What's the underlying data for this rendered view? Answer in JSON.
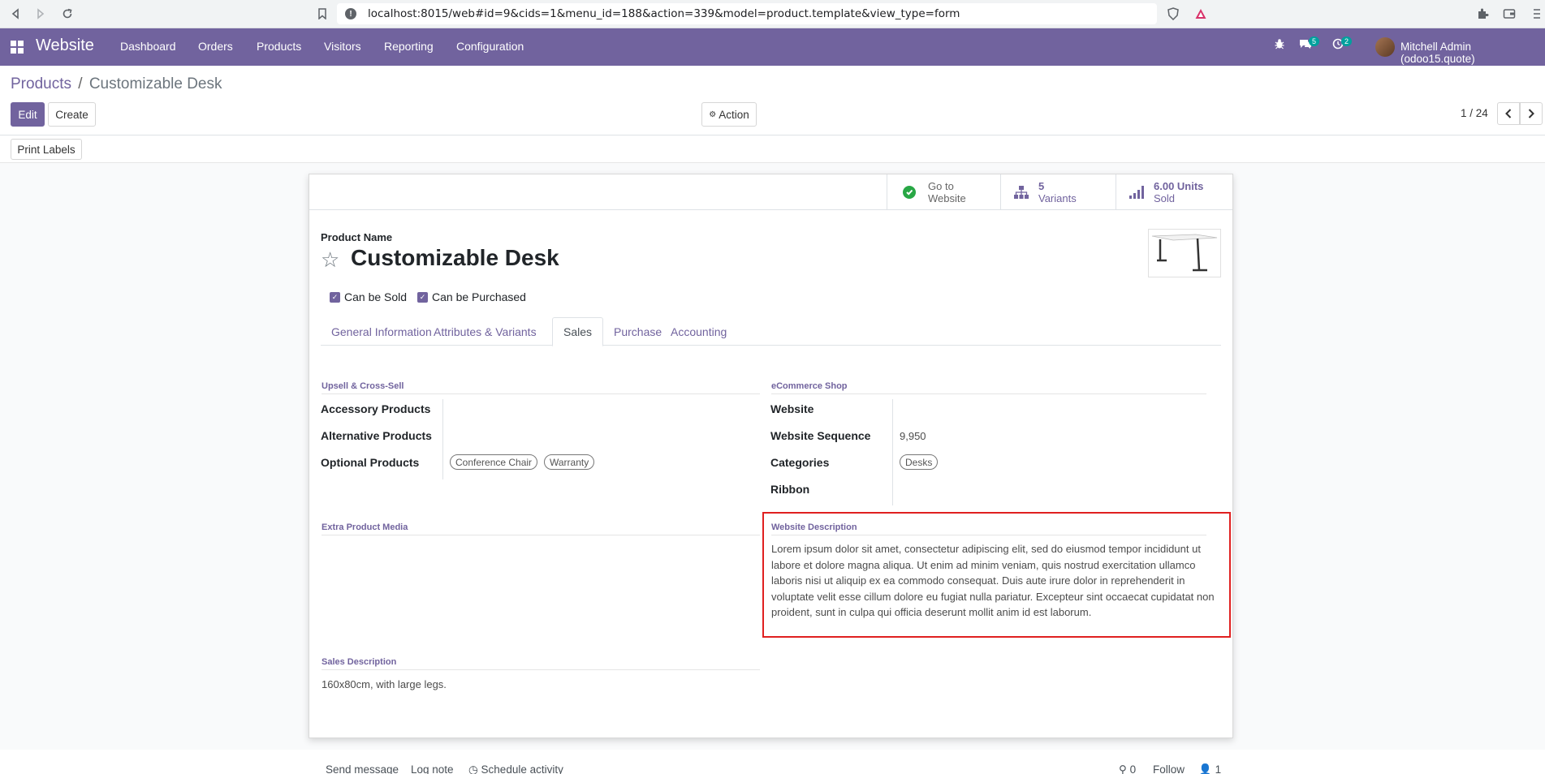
{
  "browser": {
    "url": "localhost:8015/web#id=9&cids=1&menu_id=188&action=339&model=product.template&view_type=form"
  },
  "app": {
    "name": "Website",
    "menu": [
      "Dashboard",
      "Orders",
      "Products",
      "Visitors",
      "Reporting",
      "Configuration"
    ],
    "messages_count": "5",
    "activities_count": "2",
    "user": "Mitchell Admin (odoo15.quote)"
  },
  "control_panel": {
    "breadcrumb_parent": "Products",
    "breadcrumb_separator": "/",
    "breadcrumb_current": "Customizable Desk",
    "edit_label": "Edit",
    "create_label": "Create",
    "action_label": "Action",
    "pager": "1 / 24",
    "print_labels": "Print Labels"
  },
  "stat_buttons": {
    "website_line1": "Go to",
    "website_line2": "Website",
    "variants_count": "5",
    "variants_label": "Variants",
    "sold_value": "6.00 Units",
    "sold_label": "Sold"
  },
  "product": {
    "name_label": "Product Name",
    "name": "Customizable Desk",
    "can_be_sold": "Can be Sold",
    "can_be_purchased": "Can be Purchased"
  },
  "tabs": [
    "General Information",
    "Attributes & Variants",
    "Sales",
    "Purchase",
    "Accounting"
  ],
  "sales_tab": {
    "upsell_title": "Upsell & Cross-Sell",
    "accessory_label": "Accessory Products",
    "alternative_label": "Alternative Products",
    "optional_label": "Optional Products",
    "optional_tags": [
      "Conference Chair",
      "Warranty"
    ],
    "ecommerce_title": "eCommerce Shop",
    "website_label": "Website",
    "sequence_label": "Website Sequence",
    "sequence_value": "9,950",
    "categories_label": "Categories",
    "categories_tag": "Desks",
    "ribbon_label": "Ribbon",
    "extra_media_title": "Extra Product Media",
    "website_desc_title": "Website Description",
    "website_desc_lines": [
      "Lorem ipsum dolor sit amet, consectetur adipiscing elit, sed do eiusmod tempor incididunt ut",
      "labore et dolore magna aliqua. Ut enim ad minim veniam, quis nostrud exercitation ullamco",
      "laboris nisi ut aliquip ex ea commodo consequat. Duis aute irure dolor in reprehenderit in",
      "voluptate velit esse cillum dolore eu fugiat nulla pariatur. Excepteur sint occaecat cupidatat non",
      "proident, sunt in culpa qui officia deserunt mollit anim id est laborum."
    ],
    "sales_desc_title": "Sales Description",
    "sales_desc": "160x80cm, with large legs."
  },
  "chatter": {
    "send_message": "Send message",
    "log_note": "Log note",
    "schedule_activity": "Schedule activity",
    "attachments": "0",
    "follow": "Follow",
    "followers": "1"
  },
  "colors": {
    "brand": "#71639e",
    "highlight": "#e02020"
  }
}
